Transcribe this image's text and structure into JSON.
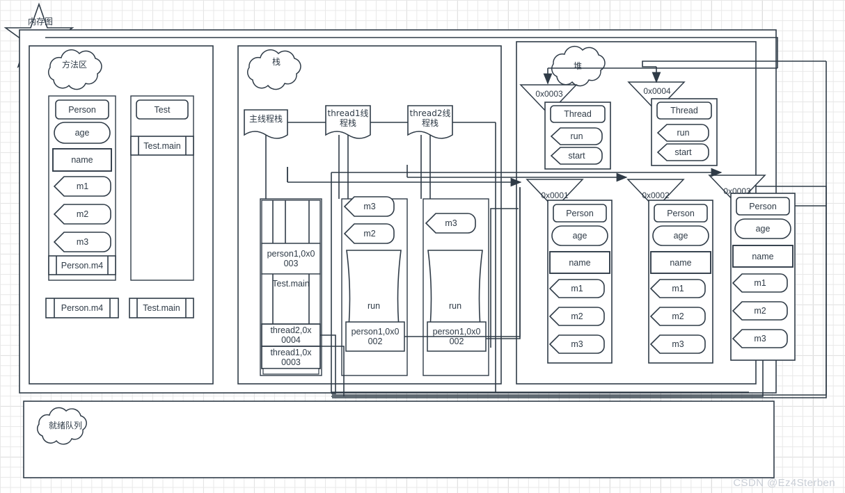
{
  "title_badge": {
    "label": "内存图",
    "shape": "star"
  },
  "watermark": "CSDN @Ez4Sterben",
  "colors": {
    "stroke": "#2f3b47",
    "fill": "#ffffff",
    "grid_minor": "#e8e8e8",
    "grid_major": "#d2d2d2",
    "watermark": "#c9ced6"
  },
  "regions": {
    "method_area": {
      "cloud_label": "方法区",
      "classes": [
        {
          "name": "Person",
          "members": [
            {
              "label": "Person",
              "kind": "class-name"
            },
            {
              "label": "age",
              "kind": "field-rounded"
            },
            {
              "label": "name",
              "kind": "field-rect"
            },
            {
              "label": "m1",
              "kind": "method"
            },
            {
              "label": "m2",
              "kind": "method"
            },
            {
              "label": "m3",
              "kind": "method"
            }
          ],
          "footer": {
            "label": "Person.m4",
            "kind": "frame"
          }
        },
        {
          "name": "Test",
          "members": [
            {
              "label": "Test",
              "kind": "class-name"
            },
            {
              "label": "Test.main",
              "kind": "frame"
            }
          ]
        }
      ],
      "loose_frames": [
        {
          "label": "Person.m4"
        },
        {
          "label": "Test.main"
        }
      ]
    },
    "stack": {
      "cloud_label": "栈",
      "threads": [
        {
          "banner": "主线程栈",
          "frames": [
            {
              "label": "",
              "kind": "frame-empty"
            },
            {
              "label": "person1,0x0\n003",
              "kind": "slot"
            },
            {
              "label": "Test.main",
              "kind": "frame"
            },
            {
              "label": "thread2,0x\n0004",
              "kind": "slot"
            },
            {
              "label": "thread1,0x\n0003",
              "kind": "slot"
            }
          ]
        },
        {
          "banner": "thread1线\n程栈",
          "frames": [
            {
              "label": "m3",
              "kind": "method"
            },
            {
              "label": "m2",
              "kind": "method"
            },
            {
              "label": "run",
              "kind": "tape"
            },
            {
              "label": "person1,0x0\n002",
              "kind": "slot"
            }
          ]
        },
        {
          "banner": "thread2线\n程栈",
          "frames": [
            {
              "label": "m3",
              "kind": "method"
            },
            {
              "label": "run",
              "kind": "tape"
            },
            {
              "label": "person1,0x0\n002",
              "kind": "slot"
            }
          ]
        }
      ]
    },
    "heap": {
      "cloud_label": "堆",
      "objects": [
        {
          "address": "0x0003",
          "type": "Thread",
          "members": [
            {
              "label": "Thread",
              "kind": "class-name"
            },
            {
              "label": "run",
              "kind": "method"
            },
            {
              "label": "start",
              "kind": "method"
            }
          ]
        },
        {
          "address": "0x0004",
          "type": "Thread",
          "members": [
            {
              "label": "Thread",
              "kind": "class-name"
            },
            {
              "label": "run",
              "kind": "method"
            },
            {
              "label": "start",
              "kind": "method"
            }
          ]
        },
        {
          "address": "0x0001",
          "type": "Person",
          "members": [
            {
              "label": "Person",
              "kind": "class-name"
            },
            {
              "label": "age",
              "kind": "field-rounded"
            },
            {
              "label": "name",
              "kind": "field-rect"
            },
            {
              "label": "m1",
              "kind": "method"
            },
            {
              "label": "m2",
              "kind": "method"
            },
            {
              "label": "m3",
              "kind": "method"
            }
          ]
        },
        {
          "address": "0x0002",
          "type": "Person",
          "members": [
            {
              "label": "Person",
              "kind": "class-name"
            },
            {
              "label": "age",
              "kind": "field-rounded"
            },
            {
              "label": "name",
              "kind": "field-rect"
            },
            {
              "label": "m1",
              "kind": "method"
            },
            {
              "label": "m2",
              "kind": "method"
            },
            {
              "label": "m3",
              "kind": "method"
            }
          ]
        },
        {
          "address": "0x0003",
          "type": "Person",
          "members": [
            {
              "label": "Person",
              "kind": "class-name"
            },
            {
              "label": "age",
              "kind": "field-rounded"
            },
            {
              "label": "name",
              "kind": "field-rect"
            },
            {
              "label": "m1",
              "kind": "method"
            },
            {
              "label": "m2",
              "kind": "method"
            },
            {
              "label": "m3",
              "kind": "method"
            }
          ]
        }
      ]
    },
    "ready_queue": {
      "cloud_label": "就绪队列",
      "items": []
    }
  },
  "labels": {
    "star": "内存图",
    "method_area": "方法区",
    "stack": "栈",
    "heap": "堆",
    "ready_queue": "就绪队列",
    "person_class": "Person",
    "test_class": "Test",
    "thread_class": "Thread",
    "age": "age",
    "name": "name",
    "m1": "m1",
    "m2": "m2",
    "m3": "m3",
    "m4_frame": "Person.m4",
    "test_main": "Test.main",
    "run": "run",
    "start": "start",
    "main_stack": "主线程栈",
    "t1_stack": "thread1线\n程栈",
    "t2_stack": "thread2线\n程栈",
    "p1_0003": "person1,0x0\n003",
    "p1_0002a": "person1,0x0\n002",
    "p1_0002b": "person1,0x0\n002",
    "thread2_0004": "thread2,0x\n0004",
    "thread1_0003": "thread1,0x\n0003",
    "addr_0003a": "0x0003",
    "addr_0004": "0x0004",
    "addr_0001": "0x0001",
    "addr_0002": "0x0002",
    "addr_0003b": "0x0003"
  }
}
